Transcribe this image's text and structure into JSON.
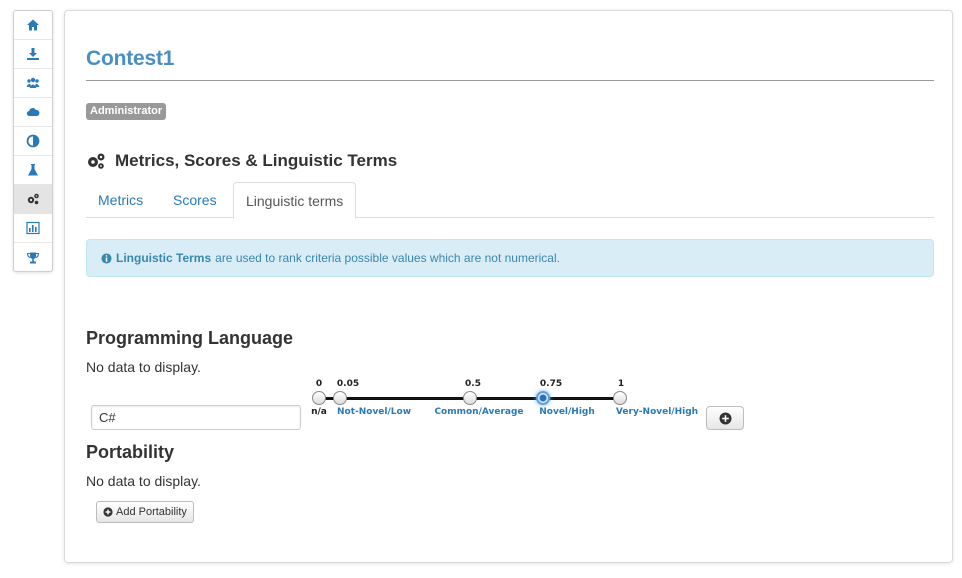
{
  "sidebar": {
    "items": [
      {
        "icon": "home-icon"
      },
      {
        "icon": "download-icon"
      },
      {
        "icon": "users-icon"
      },
      {
        "icon": "cloud-icon"
      },
      {
        "icon": "contrast-icon"
      },
      {
        "icon": "flask-icon"
      },
      {
        "icon": "cogs-icon",
        "active": true
      },
      {
        "icon": "bar-chart-icon"
      },
      {
        "icon": "trophy-icon"
      }
    ]
  },
  "header": {
    "title": "Contest1",
    "role_badge": "Administrator"
  },
  "section": {
    "title": "Metrics, Scores & Linguistic Terms",
    "icon": "cogs-icon"
  },
  "tabs": [
    {
      "label": "Metrics",
      "active": false
    },
    {
      "label": "Scores",
      "active": false
    },
    {
      "label": "Linguistic terms",
      "active": true
    }
  ],
  "alert": {
    "icon": "info-icon",
    "bold": "Linguistic Terms",
    "text": "are used to rank criteria possible values which are not numerical."
  },
  "criteria": [
    {
      "title": "Programming Language",
      "empty_text": "No data to display.",
      "input_value": "C#",
      "add_icon": "plus-circle-icon"
    },
    {
      "title": "Portability",
      "empty_text": "No data to display.",
      "add_button_label": "Add Portability"
    }
  ],
  "slider": {
    "selected": 3,
    "ticks": [
      {
        "value": "0",
        "label": "n/a"
      },
      {
        "value": "0.05",
        "label": "Not-Novel/Low"
      },
      {
        "value": "0.5",
        "label": "Common/Average"
      },
      {
        "value": "0.75",
        "label": "Novel/High"
      },
      {
        "value": "1",
        "label": "Very-Novel/High"
      }
    ]
  },
  "colors": {
    "accent": "#2a7ab8",
    "title": "#4a8fbf",
    "alert_bg": "#d9edf7",
    "alert_text": "#3a87ad"
  }
}
